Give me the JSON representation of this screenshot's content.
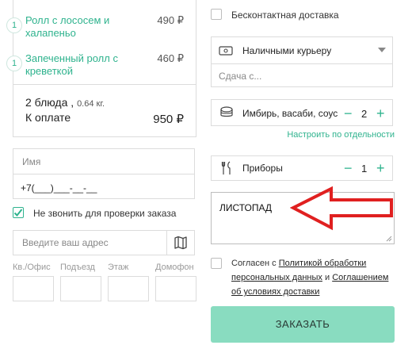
{
  "cart": {
    "items": [
      {
        "qty": "1",
        "name": "Ролл с лососем и халапеньо",
        "price": "490 ₽"
      },
      {
        "qty": "1",
        "name": "Запеченный ролл с креветкой",
        "price": "460 ₽"
      }
    ],
    "dishes_count": "2 блюда ,",
    "weight": "0.64 кг.",
    "to_pay_label": "К оплате",
    "total": "950 ₽"
  },
  "contact": {
    "name_placeholder": "Имя",
    "phone_value": "+7(___)___-__-__",
    "no_call_label": "Не звонить для проверки заказа",
    "no_call_checked": true,
    "address_placeholder": "Введите ваш адрес",
    "address_fields": [
      "Кв./Офис",
      "Подъезд",
      "Этаж",
      "Домофон"
    ]
  },
  "delivery": {
    "contactless_label": "Бесконтактная доставка",
    "payment_selected": "Наличными курьеру",
    "change_placeholder": "Сдача с..."
  },
  "extras": {
    "condiments_label": "Имбирь, васаби, соус",
    "condiments_qty": "2",
    "configure_link": "Настроить по отдельности",
    "cutlery_label": "Приборы",
    "cutlery_qty": "1",
    "minus": "−",
    "plus": "+"
  },
  "comment": {
    "value": "ЛИСТОПАД"
  },
  "agreement": {
    "prefix": "Согласен с",
    "policy_link": "Политикой обработки персональных данных",
    "and_text": "и",
    "terms_link": "Соглашением об условиях доставки"
  },
  "submit": {
    "label": "ЗАКАЗАТЬ"
  },
  "colors": {
    "accent": "#2fb38e",
    "button": "#89dcc0",
    "annotation_arrow": "#e02020"
  },
  "icons": [
    "wallet-icon",
    "dropdown-arrow-icon",
    "condiments-icon",
    "cutlery-icon",
    "map-icon",
    "checkmark-icon",
    "annotation-arrow"
  ]
}
